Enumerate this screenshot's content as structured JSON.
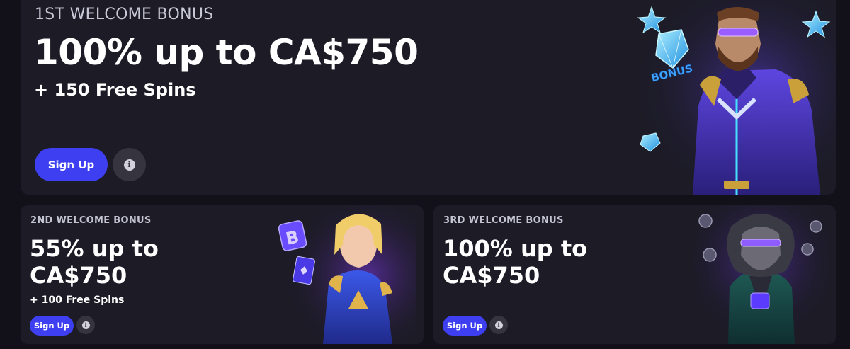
{
  "bonuses": [
    {
      "eyebrow": "1ST WELCOME BONUS",
      "headline": "100% up to CA$750",
      "subline": "+ 150 Free Spins",
      "signup_label": "Sign Up",
      "info_glyph": "i"
    },
    {
      "eyebrow": "2ND WELCOME BONUS",
      "headline": "55% up to CA$750",
      "subline": "+ 100 Free Spins",
      "signup_label": "Sign Up",
      "info_glyph": "i"
    },
    {
      "eyebrow": "3RD WELCOME BONUS",
      "headline": "100% up to CA$750",
      "signup_label": "Sign Up",
      "info_glyph": "i"
    }
  ],
  "art_text": {
    "bonus_badge": "BONUS",
    "coin_symbol": "B"
  },
  "colors": {
    "page_bg": "#121119",
    "card_bg": "#1c1b26",
    "signup_button": "#3d3ff0",
    "info_button": "#35343f",
    "accent_purple": "#7b3cff",
    "accent_cyan": "#3fd4ff"
  },
  "icons": [
    "star-icon",
    "gem-icon",
    "bitcoin-icon",
    "info-icon",
    "coin-icon"
  ]
}
